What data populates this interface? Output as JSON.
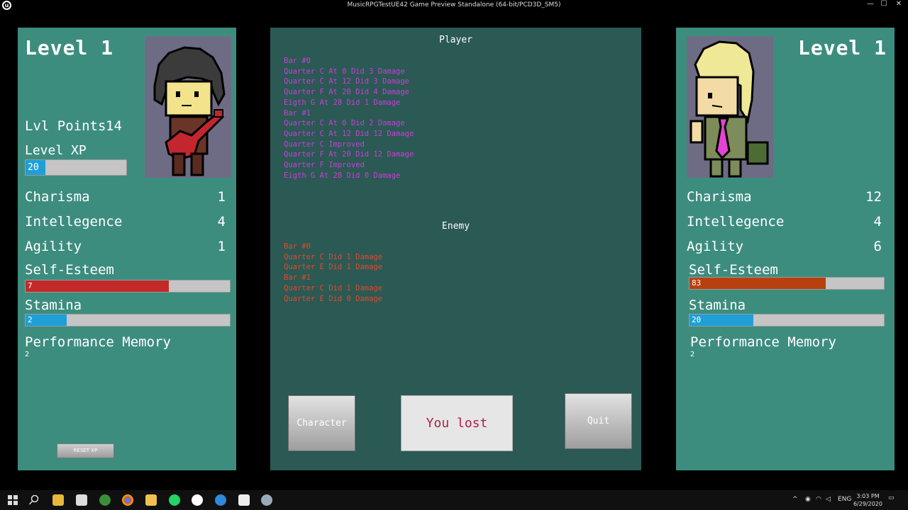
{
  "window": {
    "title": "MusicRPGTestUE42 Game Preview Standalone (64-bit/PCD3D_SM5)",
    "logo_text": "u",
    "minimize": "—",
    "maximize": "☐",
    "close": "✕"
  },
  "player": {
    "level_title": "Level 1",
    "lvl_points_label": "Lvl Points",
    "lvl_points_value": "14",
    "level_xp_label": "Level XP",
    "level_xp_value": "20",
    "level_xp_fraction": 0.2,
    "stats": [
      {
        "label": "Charisma",
        "value": "1"
      },
      {
        "label": "Intellegence",
        "value": "4"
      },
      {
        "label": "Agility",
        "value": "1"
      }
    ],
    "self_esteem_label": "Self-Esteem",
    "self_esteem_value": "7",
    "self_esteem_fraction": 0.7,
    "stamina_label": "Stamina",
    "stamina_value": "2",
    "stamina_fraction": 0.2,
    "perf_memory_label": "Performance Memory",
    "perf_memory_value": "2",
    "reset_xp_label": "RESET XP",
    "colors": {
      "self_esteem": "#c22a2a",
      "stamina": "#1e9fd8"
    }
  },
  "enemy": {
    "level_title": "Level 1",
    "stats": [
      {
        "label": "Charisma",
        "value": "12"
      },
      {
        "label": "Intellegence",
        "value": "4"
      },
      {
        "label": "Agility",
        "value": "6"
      }
    ],
    "self_esteem_label": "Self-Esteem",
    "self_esteem_value": "83",
    "self_esteem_fraction": 0.7,
    "stamina_label": "Stamina",
    "stamina_value": "20",
    "stamina_fraction": 0.33,
    "perf_memory_label": "Performance Memory",
    "perf_memory_value": "2",
    "colors": {
      "self_esteem": "#b8400f",
      "stamina": "#1e9fd8"
    }
  },
  "battle_log": {
    "player_heading": "Player",
    "player_lines": [
      "Bar #0",
      "Quarter C At 0 Did 3 Damage",
      "Quarter C At 12 Did 3 Damage",
      "Quarter F At 20 Did 4 Damage",
      "Eigth G At 28 Did 1 Damage",
      "Bar #1",
      "Quarter C At 0 Did 2 Damage",
      "Quarter C At 12 Did 12 Damage",
      "Quarter C Improved",
      "Quarter F At 20 Did 12 Damage",
      "Quarter F Improved",
      "Eigth G At 28 Did 0 Damage"
    ],
    "enemy_heading": "Enemy",
    "enemy_lines": [
      "Bar #0",
      "Quarter C Did 1 Damage",
      "Quarter E Did 1 Damage",
      "Bar #1",
      "Quarter C Did 1 Damage",
      "Quarter E Did 0 Damage"
    ],
    "colors": {
      "player": "#c83fd8",
      "enemy": "#e2492a"
    }
  },
  "buttons": {
    "character": "Character",
    "result": "You lost",
    "quit": "Quit"
  },
  "taskbar": {
    "lang": "ENG",
    "time": "3:03 PM",
    "date": "6/29/2020"
  }
}
